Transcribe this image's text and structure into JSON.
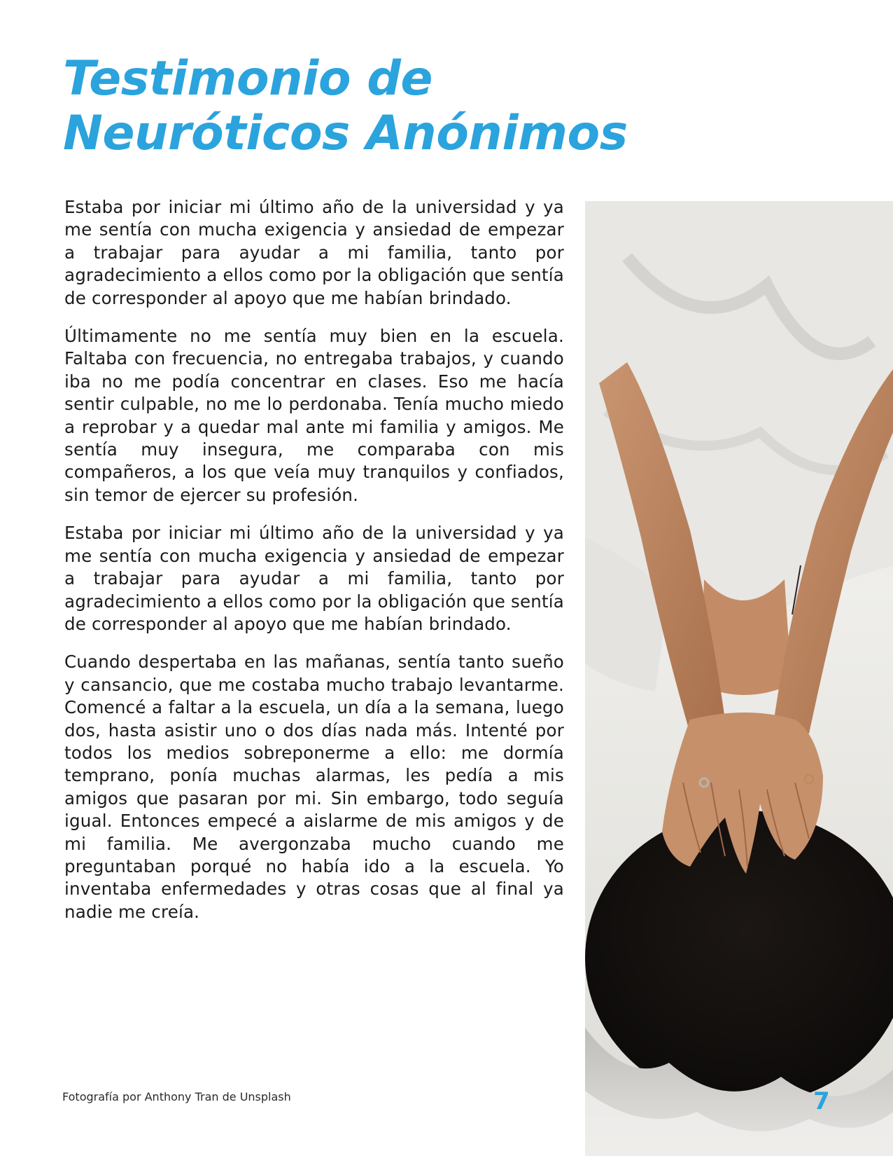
{
  "title": {
    "line1": "Testimonio de",
    "line2": "Neuróticos Anónimos"
  },
  "paragraphs": [
    "Estaba por iniciar mi último año de la universidad y ya me sentía con mucha exigencia y ansiedad de empezar a trabajar para ayudar a mi familia, tanto por agradecimiento a ellos como por la obligación que sentía de corresponder al apoyo que me habían brindado.",
    "Últimamente no me sentía muy bien en la escuela. Faltaba con frecuencia, no entregaba trabajos, y cuando iba no me podía concentrar en clases. Eso me hacía sentir culpable, no me lo perdonaba. Tenía mucho miedo a reprobar y a quedar mal ante mi familia y amigos. Me sentía muy insegura, me comparaba con mis compañeros, a los que veía muy tranquilos y confiados, sin temor de ejercer su profesión.",
    "Estaba por iniciar mi último año de la universidad y ya me sentía con mucha exigencia y ansiedad de empezar a trabajar para ayudar a mi familia, tanto por agradecimiento a ellos como por la obligación que sentía de corresponder al apoyo que me habían brindado.",
    "Cuando despertaba en las mañanas, sentía tanto sueño y cansancio, que me costaba mucho trabajo levantarme. Comencé a faltar a la escuela, un día a la semana, luego dos, hasta asistir uno o dos días nada más. Intenté por todos los medios sobreponerme a ello: me dormía temprano, ponía muchas alarmas, les pedía  a mis amigos que pasaran por mi. Sin embargo, todo seguía igual. Entonces empecé a aislarme de mis amigos y de mi familia. Me avergonzaba mucho cuando me preguntaban porqué no había ido a la escuela. Yo inventaba enfermedades y otras cosas que al final ya nadie me creía."
  ],
  "photo_credit": "Fotografía por Anthony Tran de Unsplash",
  "page_number": "7",
  "colors": {
    "accent": "#2ba3dd",
    "text": "#1b1b1b"
  }
}
